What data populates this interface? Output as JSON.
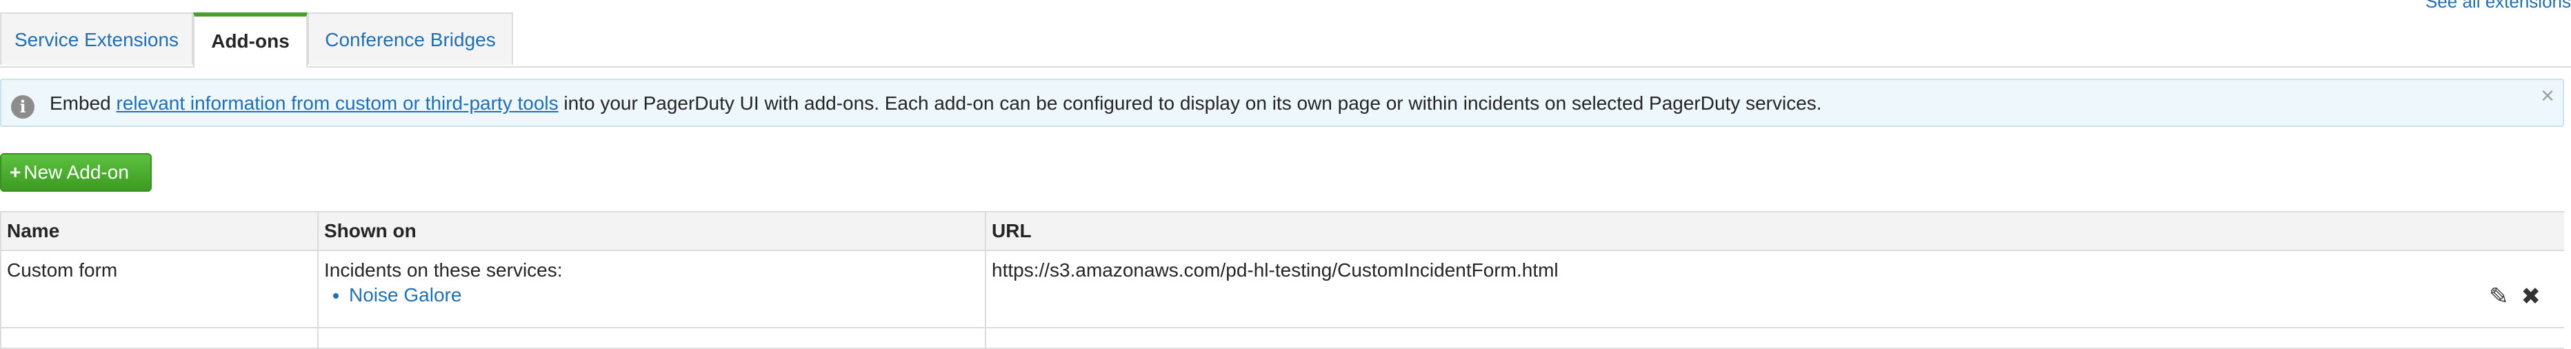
{
  "top_link": "See all extensions",
  "tabs": [
    {
      "label": "Service Extensions"
    },
    {
      "label": "Add-ons"
    },
    {
      "label": "Conference Bridges"
    }
  ],
  "banner": {
    "before": "Embed ",
    "link": "relevant information from custom or third-party tools",
    "after": " into your PagerDuty UI with add-ons. Each add-on can be configured to display on its own page or within incidents on selected PagerDuty services.",
    "close": "×"
  },
  "new_button": {
    "icon": "+",
    "label": "New Add-on"
  },
  "table": {
    "headers": [
      "Name",
      "Shown on",
      "URL"
    ],
    "rows": [
      {
        "name": "Custom form",
        "shown_on": "Incidents on these services:",
        "services": [
          "Noise Galore"
        ],
        "url": "https://s3.amazonaws.com/pd-hl-testing/CustomIncidentForm.html"
      }
    ]
  },
  "icons": {
    "info": "info-icon",
    "edit": "edit-icon",
    "delete": "delete-icon",
    "close": "close-icon"
  },
  "colors": {
    "accent": "#4a9d2f",
    "link": "#1f6fb2",
    "banner_bg": "#eef7fb"
  }
}
